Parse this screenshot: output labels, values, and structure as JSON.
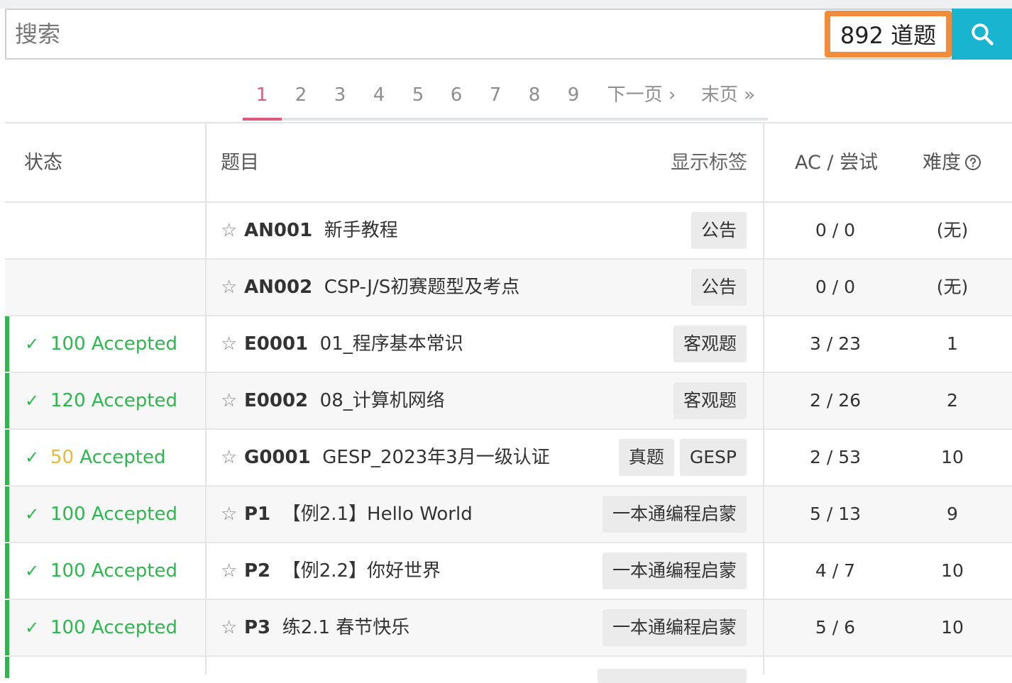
{
  "search": {
    "placeholder": "搜索",
    "count_label": "892 道题"
  },
  "pagination": {
    "pages": [
      "1",
      "2",
      "3",
      "4",
      "5",
      "6",
      "7",
      "8",
      "9"
    ],
    "active": "1",
    "next_label": "下一页 ›",
    "last_label": "末页 »"
  },
  "table": {
    "headers": {
      "status": "状态",
      "title": "题目",
      "show_tags": "显示标签",
      "ac_attempts": "AC / 尝试",
      "difficulty": "难度"
    },
    "rows": [
      {
        "status": "",
        "status_color": "",
        "pid": "AN001",
        "title": "新手教程",
        "tags": [
          "公告"
        ],
        "ac": "0 / 0",
        "difficulty": "(无)"
      },
      {
        "status": "",
        "status_color": "",
        "pid": "AN002",
        "title": "CSP-J/S初赛题型及考点",
        "tags": [
          "公告"
        ],
        "ac": "0 / 0",
        "difficulty": "(无)"
      },
      {
        "status": "100 Accepted",
        "status_color": "#2db84d",
        "pid": "E0001",
        "title": "01_程序基本常识",
        "tags": [
          "客观题"
        ],
        "ac": "3 / 23",
        "difficulty": "1"
      },
      {
        "status": "120 Accepted",
        "status_color": "#2db84d",
        "pid": "E0002",
        "title": "08_计算机网络",
        "tags": [
          "客观题"
        ],
        "ac": "2 / 26",
        "difficulty": "2"
      },
      {
        "status_num": "50",
        "status_rest": " Accepted",
        "status_color": "#2db84d",
        "num_color": "#e8b93a",
        "pid": "G0001",
        "title": "GESP_2023年3月一级认证",
        "tags": [
          "真题",
          "GESP"
        ],
        "ac": "2 / 53",
        "difficulty": "10"
      },
      {
        "status": "100 Accepted",
        "status_color": "#2db84d",
        "pid": "P1",
        "title": "【例2.1】Hello World",
        "tags": [
          "一本通编程启蒙"
        ],
        "ac": "5 / 13",
        "difficulty": "9"
      },
      {
        "status": "100 Accepted",
        "status_color": "#2db84d",
        "pid": "P2",
        "title": "【例2.2】你好世界",
        "tags": [
          "一本通编程启蒙"
        ],
        "ac": "4 / 7",
        "difficulty": "10"
      },
      {
        "status": "100 Accepted",
        "status_color": "#2db84d",
        "pid": "P3",
        "title": "练2.1 春节快乐",
        "tags": [
          "一本通编程启蒙"
        ],
        "ac": "5 / 6",
        "difficulty": "10"
      }
    ]
  },
  "icons": {
    "search": "search-icon",
    "star": "star-outline-icon",
    "check": "check-icon",
    "help": "question-circle-icon"
  },
  "colors": {
    "accent": "#18b4d0",
    "highlight_border": "#f08c3b",
    "pager_active": "#de5a7a",
    "accepted": "#2db84d",
    "partial": "#e8b93a"
  }
}
